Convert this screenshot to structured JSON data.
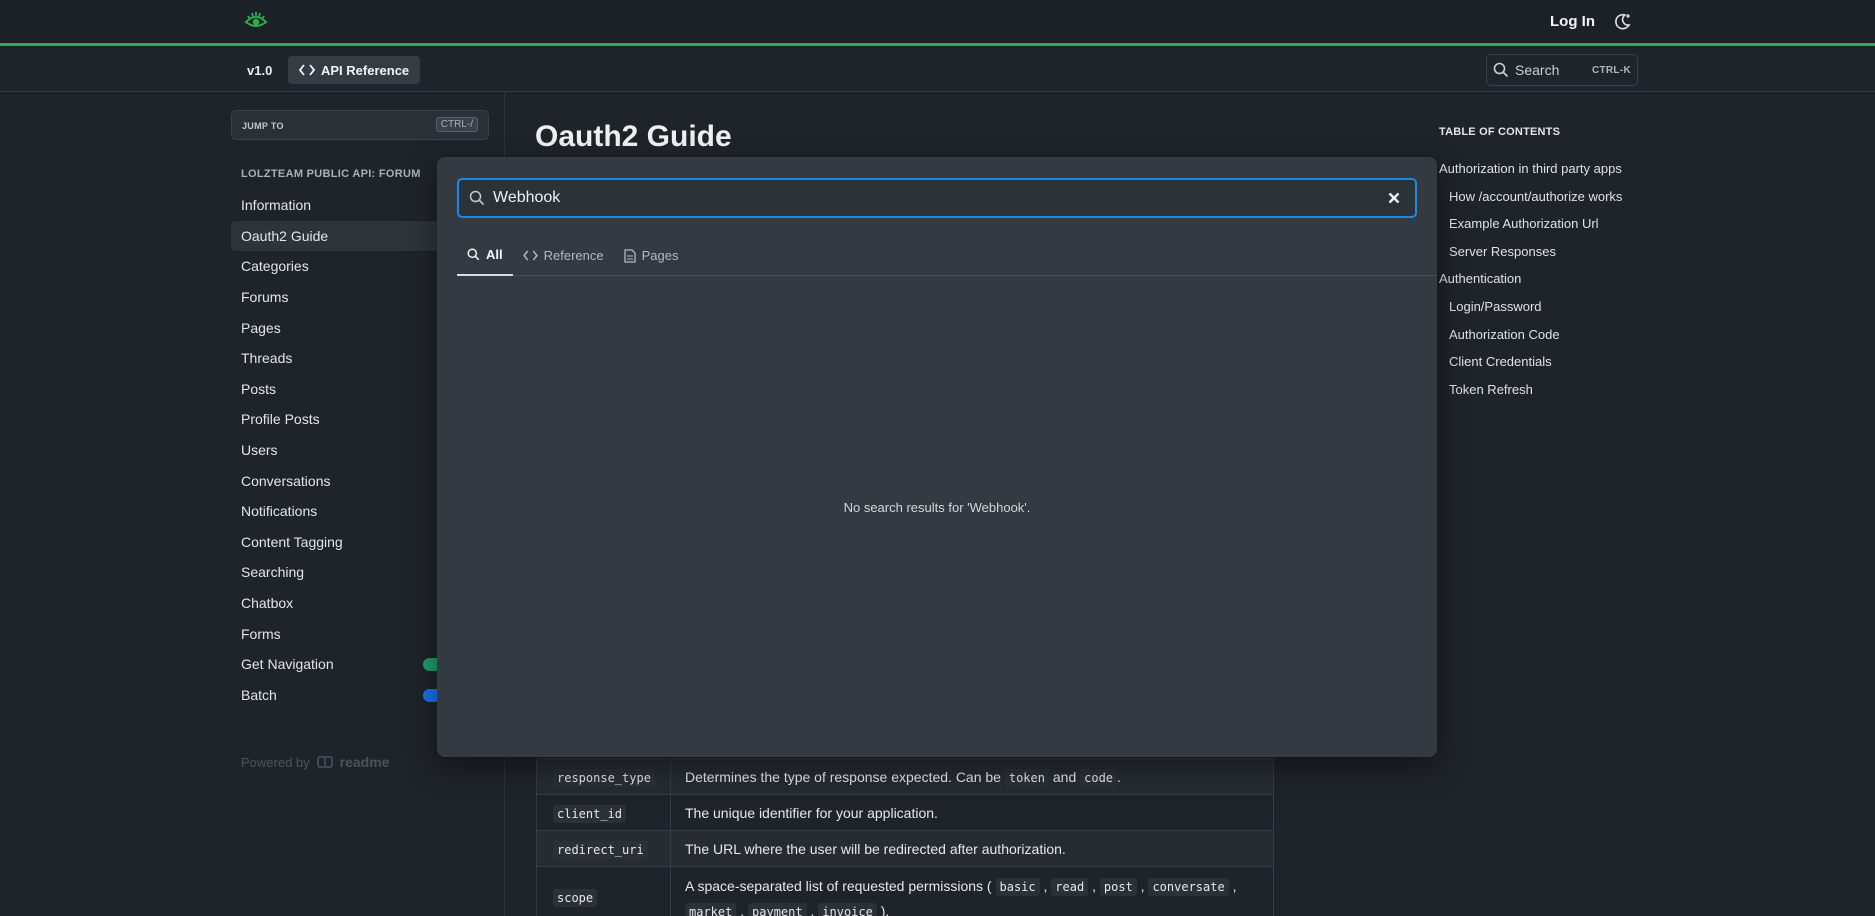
{
  "header": {
    "login_label": "Log In",
    "accent_color": "#2eaa4f"
  },
  "subheader": {
    "version": "v1.0",
    "api_reference_label": "API Reference",
    "search_label": "Search",
    "search_shortcut": "CTRL-K"
  },
  "sidebar": {
    "jump_to_label": "JUMP TO",
    "jump_to_shortcut": "CTRL-/",
    "section_title": "LOLZTEAM PUBLIC API: FORUM",
    "items": [
      {
        "label": "Information"
      },
      {
        "label": "Oauth2 Guide",
        "active": true
      },
      {
        "label": "Categories"
      },
      {
        "label": "Forums"
      },
      {
        "label": "Pages"
      },
      {
        "label": "Threads"
      },
      {
        "label": "Posts"
      },
      {
        "label": "Profile Posts"
      },
      {
        "label": "Users"
      },
      {
        "label": "Conversations"
      },
      {
        "label": "Notifications"
      },
      {
        "label": "Content Tagging"
      },
      {
        "label": "Searching"
      },
      {
        "label": "Chatbox"
      },
      {
        "label": "Forms"
      },
      {
        "label": "Get Navigation",
        "badge_color": "#1e9e6a"
      },
      {
        "label": "Batch",
        "badge_color": "#1a73e8"
      }
    ],
    "powered_by": "Powered by",
    "powered_brand": "readme"
  },
  "main": {
    "title": "Oauth2 Guide",
    "params": [
      {
        "key": "response_type",
        "desc_parts": [
          "Determines the type of response expected. Can be ",
          "token",
          " and ",
          "code",
          "."
        ]
      },
      {
        "key": "client_id",
        "desc": "The unique identifier for your application."
      },
      {
        "key": "redirect_uri",
        "desc": "The URL where the user will be redirected after authorization."
      },
      {
        "key": "scope",
        "desc_prefix": "A space-separated list of requested permissions ( ",
        "scopes": [
          "basic",
          "read",
          "post",
          "conversate",
          "market",
          "payment",
          "invoice"
        ],
        "desc_suffix": " )."
      }
    ]
  },
  "toc": {
    "title": "TABLE OF CONTENTS",
    "items": [
      {
        "label": "Authorization in third party apps",
        "level": 1
      },
      {
        "label": "How /account/authorize works",
        "level": 2
      },
      {
        "label": "Example Authorization Url",
        "level": 2
      },
      {
        "label": "Server Responses",
        "level": 2
      },
      {
        "label": "Authentication",
        "level": 1
      },
      {
        "label": "Login/Password",
        "level": 2
      },
      {
        "label": "Authorization Code",
        "level": 2
      },
      {
        "label": "Client Credentials",
        "level": 2
      },
      {
        "label": "Token Refresh",
        "level": 2
      }
    ]
  },
  "search_modal": {
    "query": "Webhook",
    "tabs": [
      {
        "label": "All",
        "icon": "search-icon",
        "active": true
      },
      {
        "label": "Reference",
        "icon": "code-icon"
      },
      {
        "label": "Pages",
        "icon": "page-icon"
      }
    ],
    "empty_message": "No search results for 'Webhook'.",
    "focus_color": "#1e88e5"
  }
}
